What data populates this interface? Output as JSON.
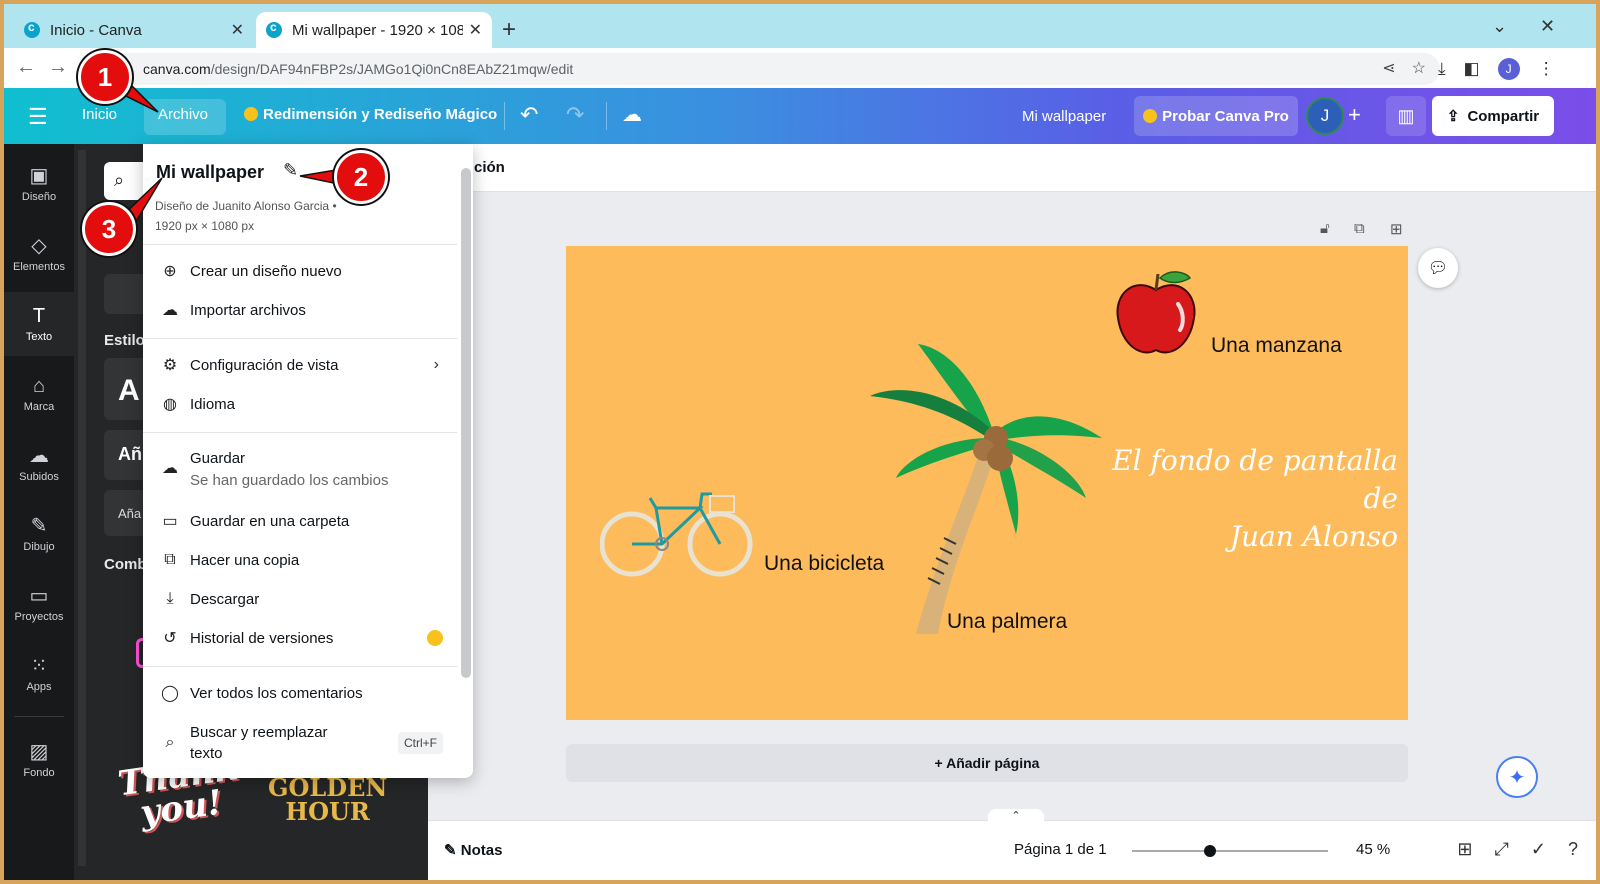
{
  "browser": {
    "tabs": [
      {
        "title": "Inicio - Canva",
        "active": false
      },
      {
        "title": "Mi wallpaper - 1920 × 108",
        "active": true
      }
    ],
    "url_domain": "canva.com",
    "url_path": "/design/DAF94nFBP2s/JAMGo1Qi0nCn8EAbZ21mqw/edit",
    "profile_initial": "J"
  },
  "topbar": {
    "home": "Inicio",
    "file": "Archivo",
    "resize": "Redimensión y Rediseño Mágico",
    "design_name": "Mi wallpaper",
    "try_pro": "Probar Canva Pro",
    "user_initial": "J",
    "share": "Compartir"
  },
  "rail": {
    "items": [
      {
        "label": "Diseño",
        "icon": "layout-icon"
      },
      {
        "label": "Elementos",
        "icon": "shapes-icon"
      },
      {
        "label": "Texto",
        "icon": "text-icon"
      },
      {
        "label": "Marca",
        "icon": "brand-icon"
      },
      {
        "label": "Subidos",
        "icon": "upload-icon"
      },
      {
        "label": "Dibujo",
        "icon": "draw-icon"
      },
      {
        "label": "Proyectos",
        "icon": "folder-icon"
      },
      {
        "label": "Apps",
        "icon": "apps-icon"
      },
      {
        "label": "Fondo",
        "icon": "background-icon"
      }
    ]
  },
  "panel": {
    "styles_label": "Estilo",
    "heading_sample": "A",
    "add_sample": "Añ",
    "add_small": "Aña",
    "combos_label": "Comb",
    "golden_line1": "GOLDEN",
    "golden_line2": "HOUR",
    "thanks_line1": "Thank",
    "thanks_line2": "you!"
  },
  "context_bar": {
    "text": "ción"
  },
  "design": {
    "captions": {
      "apple": "Una manzana",
      "bike": "Una bicicleta",
      "palm": "Una palmera"
    },
    "script_line1": "El fondo de pantalla de",
    "script_line2": "Juan Alonso",
    "background_color": "#fdbb5b"
  },
  "add_page": "+ Añadir página",
  "footer": {
    "notes": "Notas",
    "page_info": "Página 1 de 1",
    "zoom": "45 %",
    "zoom_fraction": 0.4
  },
  "file_menu": {
    "title": "Mi wallpaper",
    "meta_line1": "Diseño de Juanito Alonso Garcia •",
    "meta_line2": "1920 px × 1080 px",
    "items": {
      "new_design": "Crear un diseño nuevo",
      "import": "Importar archivos",
      "view_settings": "Configuración de vista",
      "language": "Idioma",
      "save": "Guardar",
      "save_status": "Se han guardado los cambios",
      "save_folder": "Guardar en una carpeta",
      "copy": "Hacer una copia",
      "download": "Descargar",
      "history": "Historial de versiones",
      "comments": "Ver todos los comentarios",
      "find_replace_1": "Buscar y reemplazar",
      "find_replace_2": "texto",
      "find_shortcut": "Ctrl+F"
    }
  },
  "annotations": [
    "1",
    "2",
    "3"
  ],
  "colors": {
    "annotation_red": "#e30d0d",
    "topbar_start": "#10bfcf",
    "topbar_end": "#7a4ee8",
    "crown_gold": "#f8c21a"
  }
}
